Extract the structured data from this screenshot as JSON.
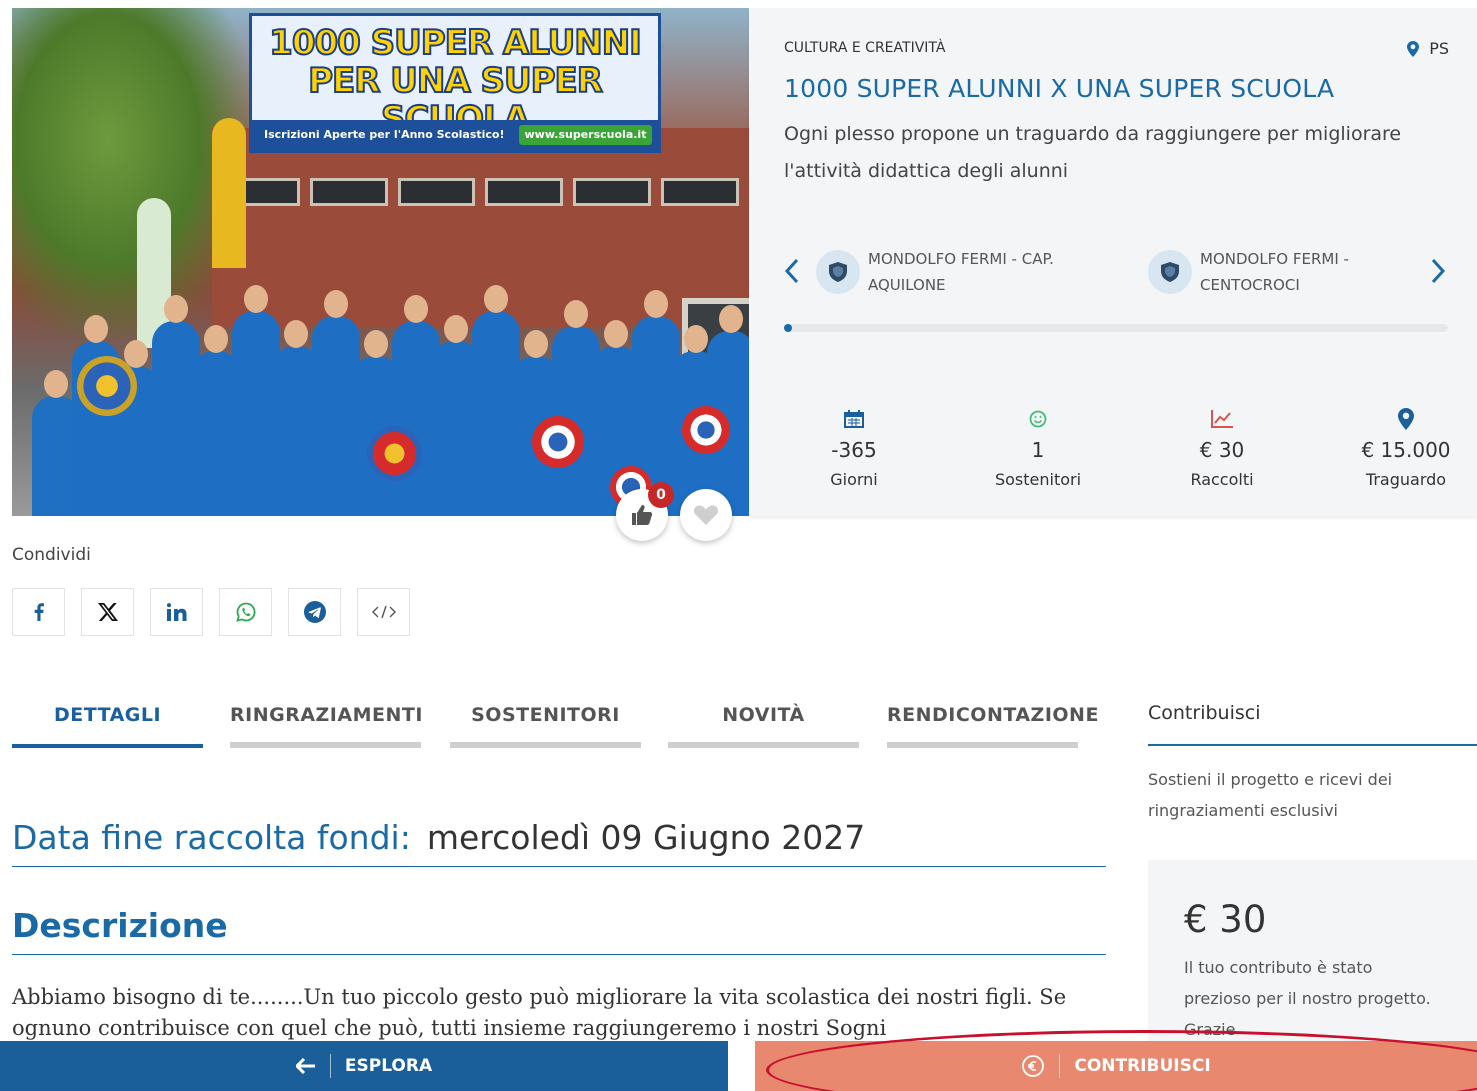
{
  "hero": {
    "banner_title_line1": "1000 SUPER ALUNNI",
    "banner_title_line2": "PER UNA SUPER SCUOLA",
    "banner_sub": "Iscrizioni Aperte per l'Anno Scolastico!",
    "banner_url": "www.superscuola.it",
    "like_count": "0"
  },
  "project": {
    "category": "CULTURA E CREATIVITÀ",
    "province": "PS",
    "title": "1000 SUPER ALUNNI X UNA SUPER SCUOLA",
    "description": "Ogni plesso propone un traguardo da raggiungere per migliorare l'attività didattica degli alunni",
    "schools": [
      {
        "name": "MONDOLFO FERMI - CAP. AQUILONE"
      },
      {
        "name": "MONDOLFO FERMI - CENTOCROCI"
      }
    ],
    "slider_progress": 0,
    "stats": [
      {
        "icon": "calendar-icon",
        "value": "-365",
        "label": "Giorni"
      },
      {
        "icon": "smiley-icon",
        "value": "1",
        "label": "Sostenitori"
      },
      {
        "icon": "chart-icon",
        "value": "€ 30",
        "label": "Raccolti"
      },
      {
        "icon": "location-icon",
        "value": "€ 15.000",
        "label": "Traguardo"
      }
    ]
  },
  "share": {
    "label": "Condividi",
    "buttons": [
      "facebook-icon",
      "x-icon",
      "linkedin-icon",
      "whatsapp-icon",
      "telegram-icon",
      "embed-code-icon"
    ]
  },
  "tabs": [
    {
      "label": "DETTAGLI",
      "active": true
    },
    {
      "label": "RINGRAZIAMENTI",
      "active": false
    },
    {
      "label": "SOSTENITORI",
      "active": false
    },
    {
      "label": "NOVITÀ",
      "active": false
    },
    {
      "label": "RENDICONTAZIONE",
      "active": false
    }
  ],
  "details": {
    "deadline_label": "Data fine raccolta fondi:",
    "deadline_value": "mercoledì 09 Giugno 2027",
    "description_title": "Descrizione",
    "description_text": "Abbiamo bisogno di te........Un tuo piccolo gesto può migliorare la vita scolastica dei nostri figli. Se ognuno contribuisce con quel che può, tutti insieme raggiungeremo i nostri Sogni"
  },
  "sidebar": {
    "title": "Contribuisci",
    "text": "Sostieni il progetto e ricevi dei ringraziamenti esclusivi",
    "reward_amount": "€ 30",
    "reward_text": "Il tuo contributo è stato prezioso per il nostro progetto. Grazie"
  },
  "bottom_bar": {
    "explore_label": "ESPLORA",
    "contribute_label": "CONTRIBUISCI"
  },
  "colors": {
    "primary_blue": "#1a6aa6",
    "bottom_blue": "#1a5f9a",
    "contribute_orange": "#e8896f",
    "highlight_red": "#c8102e"
  }
}
